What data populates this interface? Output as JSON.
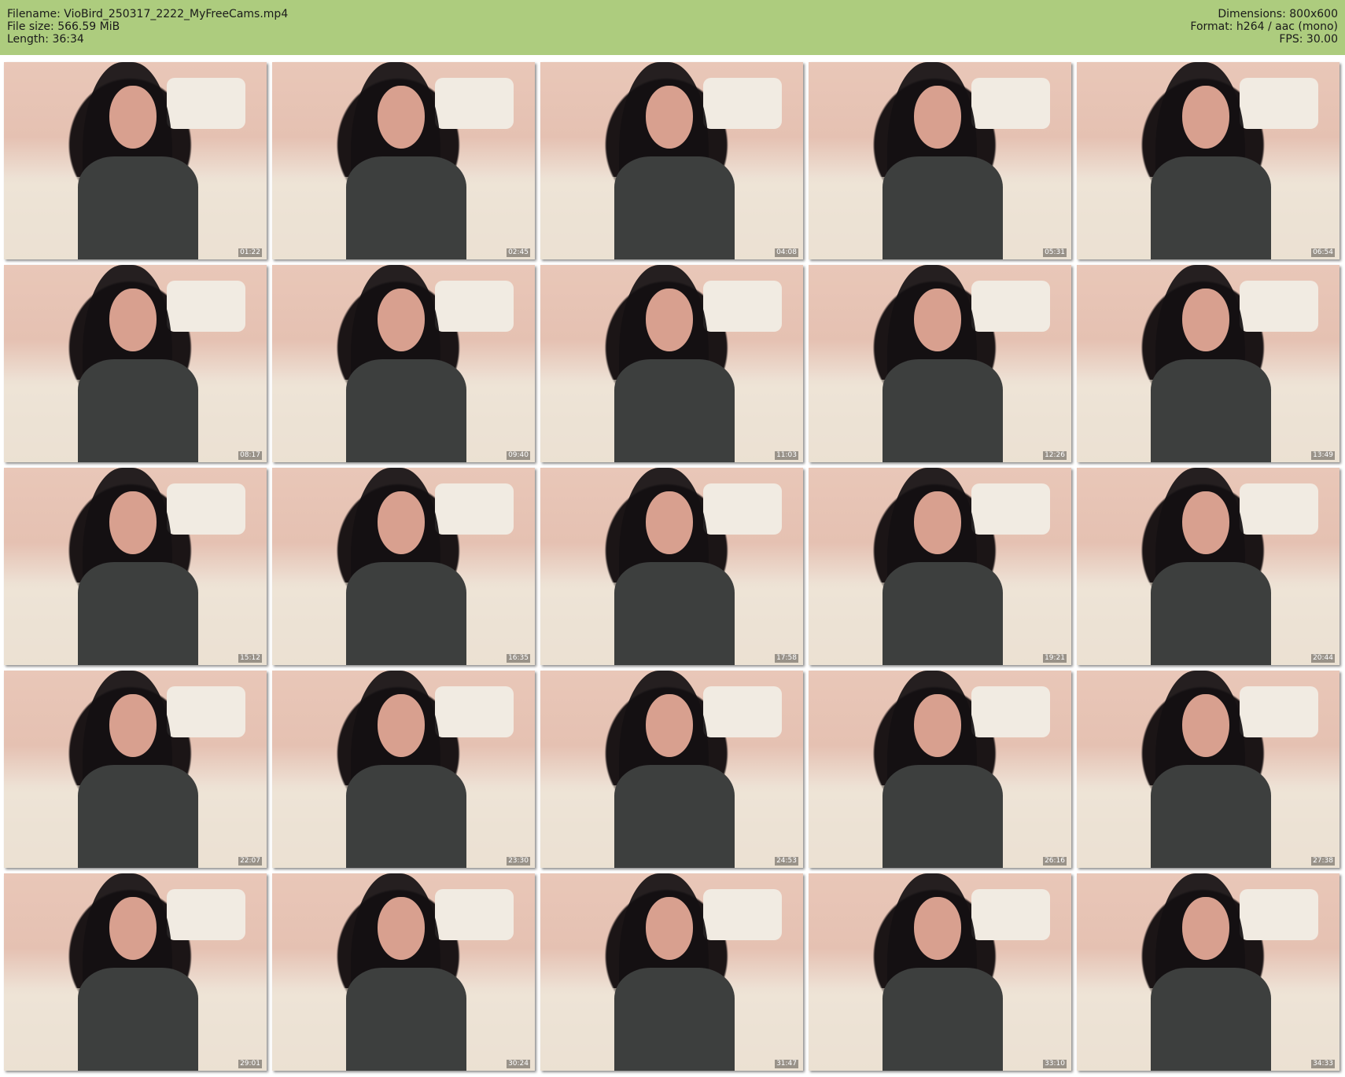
{
  "header": {
    "filename": "Filename: VioBird_250317_2222_MyFreeCams.mp4",
    "filesize": "File size: 566.59 MiB",
    "length": "Length: 36:34",
    "dimensions": "Dimensions: 800x600",
    "format": "Format: h264 / aac (mono)",
    "fps": "FPS: 30.00"
  },
  "colors": {
    "header_bg": "#adcc7e",
    "page_bg": "#ffffff"
  },
  "thumbnails": [
    {
      "time": "01:22"
    },
    {
      "time": "02:45"
    },
    {
      "time": "04:08"
    },
    {
      "time": "05:31"
    },
    {
      "time": "06:54"
    },
    {
      "time": "08:17"
    },
    {
      "time": "09:40"
    },
    {
      "time": "11:03"
    },
    {
      "time": "12:26"
    },
    {
      "time": "13:49"
    },
    {
      "time": "15:12"
    },
    {
      "time": "16:35"
    },
    {
      "time": "17:58"
    },
    {
      "time": "19:21"
    },
    {
      "time": "20:44"
    },
    {
      "time": "22:07"
    },
    {
      "time": "23:30"
    },
    {
      "time": "24:53"
    },
    {
      "time": "26:16"
    },
    {
      "time": "27:38"
    },
    {
      "time": "29:01"
    },
    {
      "time": "30:24"
    },
    {
      "time": "31:47"
    },
    {
      "time": "33:10"
    },
    {
      "time": "34:33"
    }
  ]
}
